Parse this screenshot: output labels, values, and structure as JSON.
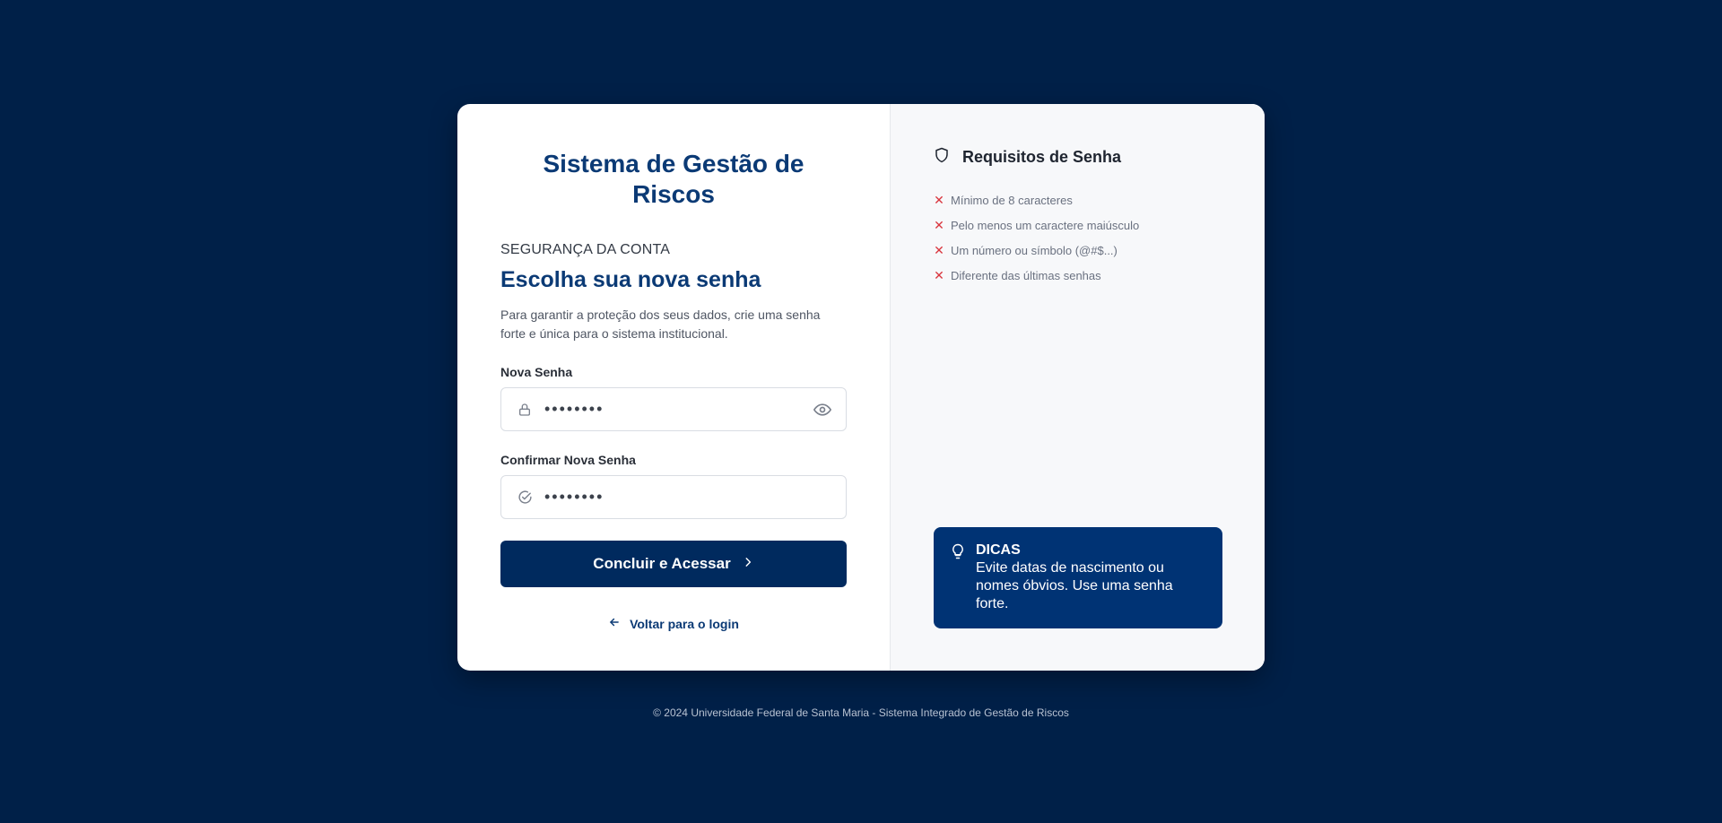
{
  "app_title": "Sistema de Gestão de Riscos",
  "form": {
    "eyebrow": "SEGURANÇA DA CONTA",
    "heading": "Escolha sua nova senha",
    "description": "Para garantir a proteção dos seus dados, crie uma senha forte e única para o sistema institucional.",
    "new_password": {
      "label": "Nova Senha",
      "value": "••••••••",
      "lead_icon": "lock-icon",
      "trail_icon": "eye-icon"
    },
    "confirm_password": {
      "label": "Confirmar Nova Senha",
      "value": "••••••••",
      "lead_icon": "check-circle-icon"
    },
    "submit_label": "Concluir e Acessar",
    "back_label": "Voltar para o login"
  },
  "requirements": {
    "title": "Requisitos de Senha",
    "icon": "shield-icon",
    "items": [
      {
        "text": "Mínimo de 8 caracteres",
        "met": false
      },
      {
        "text": "Pelo menos um caractere maiúsculo",
        "met": false
      },
      {
        "text": "Um número ou símbolo (@#$...)",
        "met": false
      },
      {
        "text": "Diferente das últimas senhas",
        "met": false
      }
    ]
  },
  "tips": {
    "title": "DICAS",
    "text": "Evite datas de nascimento ou nomes óbvios. Use uma senha forte.",
    "icon": "lightbulb-icon"
  },
  "footer": "© 2024 Universidade Federal de Santa Maria - Sistema Integrado de Gestão de Riscos",
  "colors": {
    "background": "#002048",
    "primary": "#002a5e",
    "accent_text": "#0b3a75",
    "error": "#d9363e",
    "tips_bg": "#003374"
  }
}
